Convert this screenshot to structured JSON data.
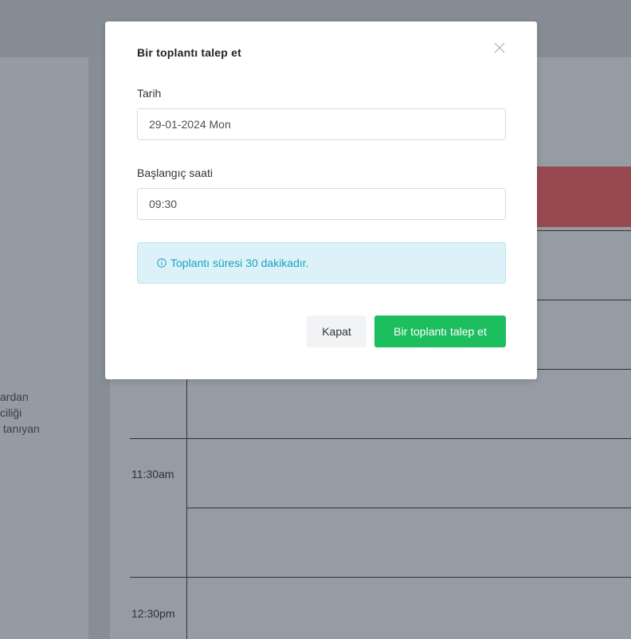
{
  "background": {
    "left_text_lines": [
      "ardan",
      "ciliği",
      " tanıyan"
    ],
    "time_labels": [
      "11:30am",
      "12:30pm"
    ],
    "colors": {
      "overlay": "#8d939b",
      "event_block": "#984950"
    }
  },
  "modal": {
    "title": "Bir toplantı talep et",
    "close_icon": "close-x-icon",
    "date_label": "Tarih",
    "date_value": "29-01-2024 Mon",
    "time_label": "Başlangıç saati",
    "time_value": "09:30",
    "info_icon": "info-circle-icon",
    "info_text": "Toplantı süresi 30 dakikadır.",
    "close_button": "Kapat",
    "submit_button": "Bir toplantı talep et",
    "colors": {
      "primary": "#1dbe5e",
      "info_text": "#17a2c1",
      "info_bg": "#dcf2f8"
    }
  }
}
